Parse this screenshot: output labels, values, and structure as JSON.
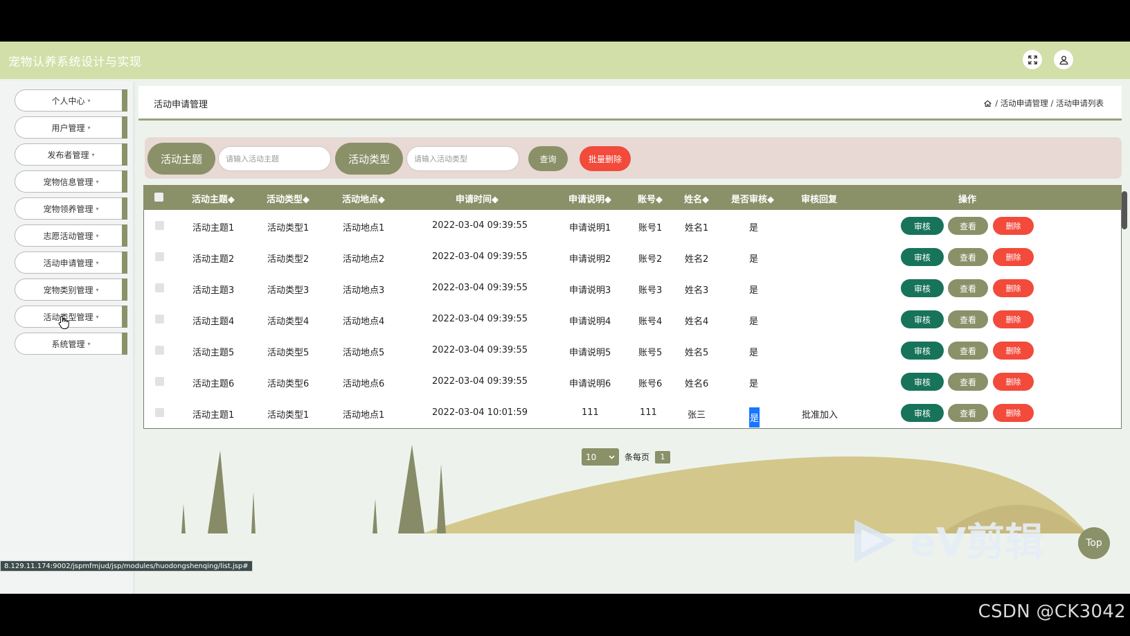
{
  "header": {
    "title": "宠物认养系统设计与实现"
  },
  "sidebar": {
    "items": [
      {
        "label": "个人中心"
      },
      {
        "label": "用户管理"
      },
      {
        "label": "发布者管理"
      },
      {
        "label": "宠物信息管理"
      },
      {
        "label": "宠物领养管理"
      },
      {
        "label": "志愿活动管理"
      },
      {
        "label": "活动申请管理"
      },
      {
        "label": "宠物类别管理"
      },
      {
        "label": "活动类型管理"
      },
      {
        "label": "系统管理"
      }
    ],
    "caret": "▾"
  },
  "page": {
    "title": "活动申请管理",
    "breadcrumb": "/ 活动申请管理 / 活动申请列表"
  },
  "search": {
    "field1_label": "活动主题",
    "field1_placeholder": "请输入活动主题",
    "field2_label": "活动类型",
    "field2_placeholder": "请输入活动类型",
    "query_label": "查询",
    "batch_delete_label": "批量删除"
  },
  "table": {
    "columns": [
      "活动主题◆",
      "活动类型◆",
      "活动地点◆",
      "申请时间◆",
      "申请说明◆",
      "账号◆",
      "姓名◆",
      "是否审核◆",
      "审核回复",
      "操作"
    ],
    "rows": [
      {
        "theme": "活动主题1",
        "type": "活动类型1",
        "place": "活动地点1",
        "time": "2022-03-04 09:39:55",
        "desc": "申请说明1",
        "account": "账号1",
        "name": "姓名1",
        "audited": "是",
        "reply": ""
      },
      {
        "theme": "活动主题2",
        "type": "活动类型2",
        "place": "活动地点2",
        "time": "2022-03-04 09:39:55",
        "desc": "申请说明2",
        "account": "账号2",
        "name": "姓名2",
        "audited": "是",
        "reply": ""
      },
      {
        "theme": "活动主题3",
        "type": "活动类型3",
        "place": "活动地点3",
        "time": "2022-03-04 09:39:55",
        "desc": "申请说明3",
        "account": "账号3",
        "name": "姓名3",
        "audited": "是",
        "reply": ""
      },
      {
        "theme": "活动主题4",
        "type": "活动类型4",
        "place": "活动地点4",
        "time": "2022-03-04 09:39:55",
        "desc": "申请说明4",
        "account": "账号4",
        "name": "姓名4",
        "audited": "是",
        "reply": ""
      },
      {
        "theme": "活动主题5",
        "type": "活动类型5",
        "place": "活动地点5",
        "time": "2022-03-04 09:39:55",
        "desc": "申请说明5",
        "account": "账号5",
        "name": "姓名5",
        "audited": "是",
        "reply": ""
      },
      {
        "theme": "活动主题6",
        "type": "活动类型6",
        "place": "活动地点6",
        "time": "2022-03-04 09:39:55",
        "desc": "申请说明6",
        "account": "账号6",
        "name": "姓名6",
        "audited": "是",
        "reply": ""
      },
      {
        "theme": "活动主题1",
        "type": "活动类型1",
        "place": "活动地点1",
        "time": "2022-03-04 10:01:59",
        "desc": "111",
        "account": "111",
        "name": "张三",
        "audited": "是",
        "reply": "批准加入"
      }
    ],
    "actions": {
      "review": "审核",
      "view": "查看",
      "delete": "删除"
    }
  },
  "pager": {
    "page_size": "10",
    "per_page_label": "条每页",
    "current_page": "1"
  },
  "top_button": "Top",
  "status_url": "8.129.11.174:9002/jspmfmjud/jsp/modules/huodongshenqing/list.jsp#",
  "watermark": "eV剪辑",
  "csdn_credit": "CSDN @CK3042",
  "colors": {
    "header_bg": "#d2dfa8",
    "olive": "#8a9068",
    "teal_green": "#17735a",
    "red": "#f24a3b",
    "search_panel": "#e8d9d4"
  }
}
